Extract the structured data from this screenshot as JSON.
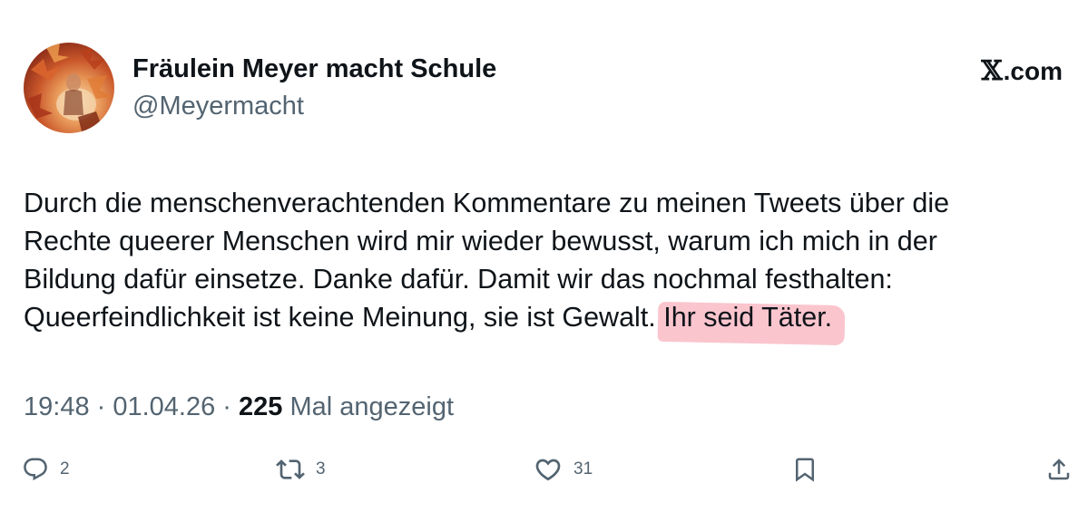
{
  "tweet": {
    "display_name": "Fräulein Meyer macht Schule",
    "handle": "@Meyermacht",
    "brand": {
      "mark": "𝕏",
      "suffix": ".com"
    },
    "text_lines": [
      "Durch die menschenverachtenden Kommentare zu meinen Tweets über die",
      "Rechte queerer Menschen wird mir wieder bewusst, warum ich mich in der",
      "Bildung dafür einsetze. Danke dafür. Damit wir das nochmal festhalten:",
      "Queerfeindlichkeit ist keine Meinung, sie ist Gewalt. "
    ],
    "highlighted_text": "Ihr seid Täter.",
    "highlight_color": "#f896a5",
    "meta": {
      "time": "19:48",
      "sep1": " · ",
      "date": "01.04.26",
      "sep2": " · ",
      "views_count": "225",
      "views_label": " Mal angezeigt"
    },
    "actions": {
      "reply": {
        "icon": "reply-icon",
        "count": "2"
      },
      "retweet": {
        "icon": "retweet-icon",
        "count": "3"
      },
      "like": {
        "icon": "heart-icon",
        "count": "31"
      },
      "bookmark": {
        "icon": "bookmark-icon"
      },
      "share": {
        "icon": "share-icon"
      }
    },
    "colors": {
      "text": "#0f1419",
      "secondary": "#536471"
    }
  }
}
